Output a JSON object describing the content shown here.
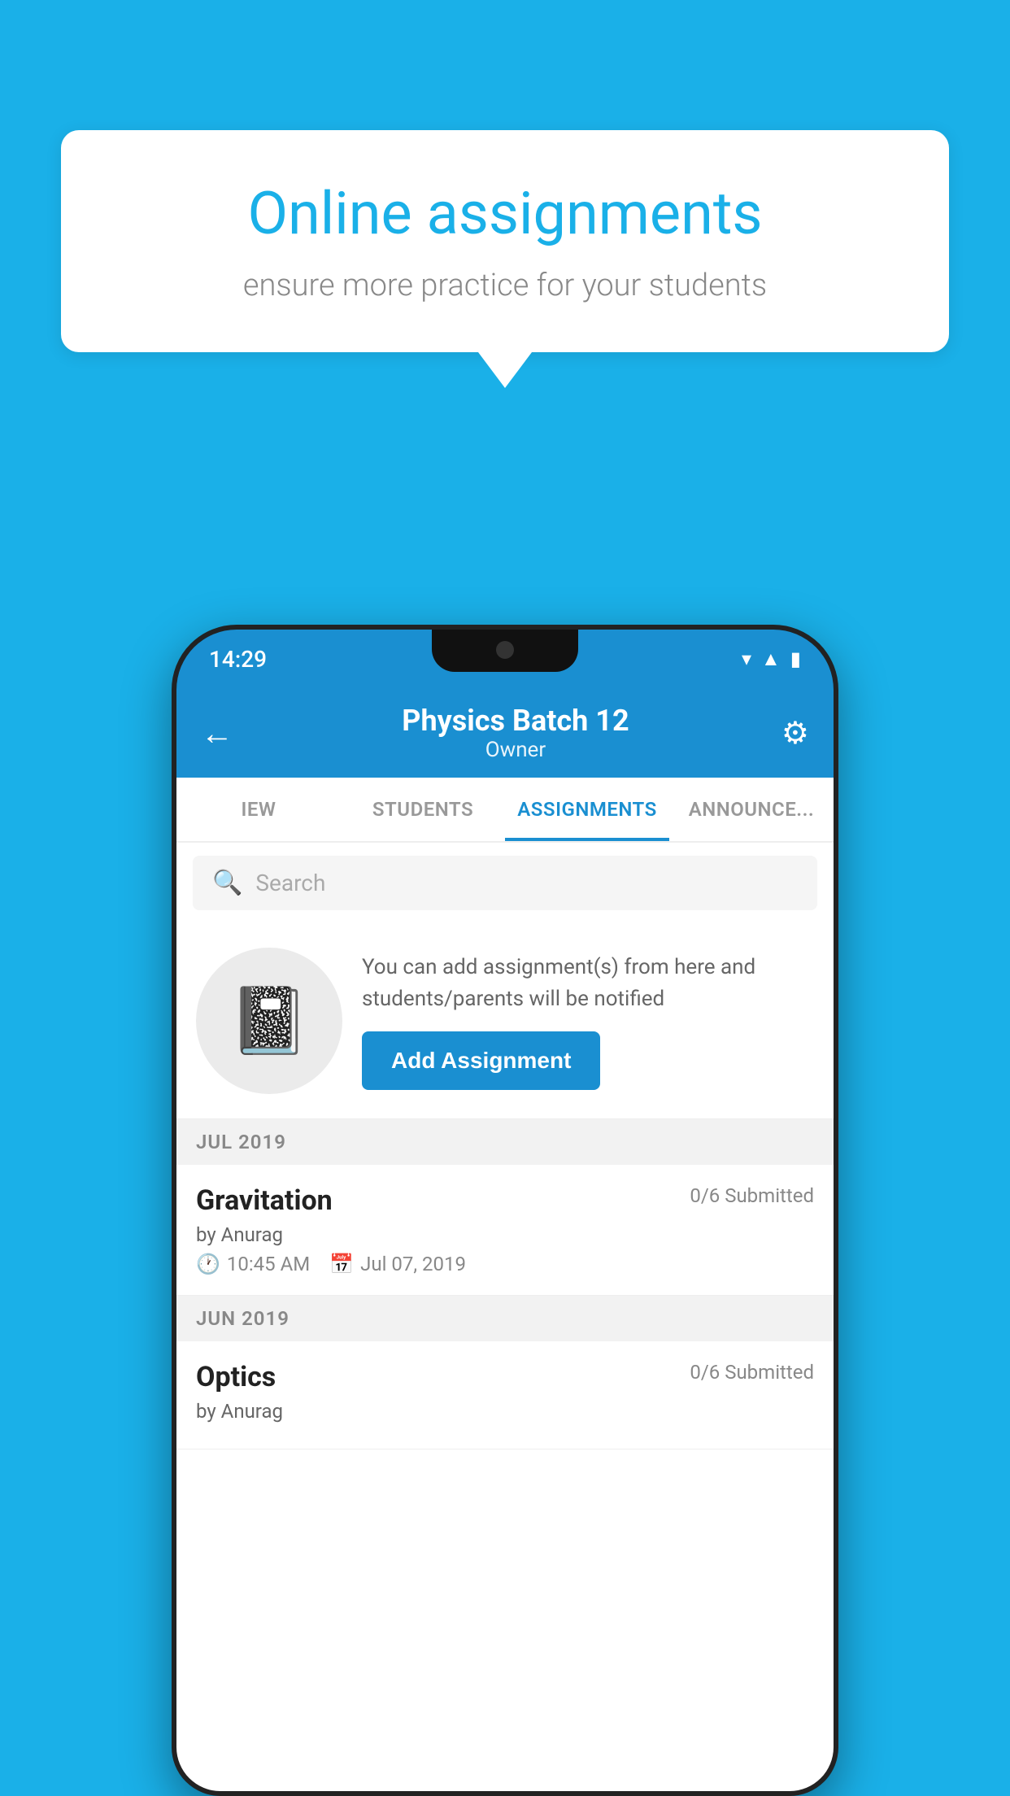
{
  "background_color": "#1ab0e8",
  "speech_bubble": {
    "title": "Online assignments",
    "subtitle": "ensure more practice for your students"
  },
  "status_bar": {
    "time": "14:29",
    "icons": [
      "wifi",
      "signal",
      "battery"
    ]
  },
  "app_header": {
    "title": "Physics Batch 12",
    "subtitle": "Owner",
    "back_label": "←",
    "settings_label": "⚙"
  },
  "tabs": [
    {
      "label": "IEW",
      "active": false
    },
    {
      "label": "STUDENTS",
      "active": false
    },
    {
      "label": "ASSIGNMENTS",
      "active": true
    },
    {
      "label": "ANNOUNCEMENTS",
      "active": false
    }
  ],
  "search": {
    "placeholder": "Search"
  },
  "promo": {
    "description": "You can add assignment(s) from here and students/parents will be notified",
    "button_label": "Add Assignment"
  },
  "month_sections": [
    {
      "month_label": "JUL 2019",
      "assignments": [
        {
          "name": "Gravitation",
          "submitted": "0/6 Submitted",
          "by": "by Anurag",
          "time": "10:45 AM",
          "date": "Jul 07, 2019"
        }
      ]
    },
    {
      "month_label": "JUN 2019",
      "assignments": [
        {
          "name": "Optics",
          "submitted": "0/6 Submitted",
          "by": "by Anurag",
          "time": "",
          "date": ""
        }
      ]
    }
  ]
}
